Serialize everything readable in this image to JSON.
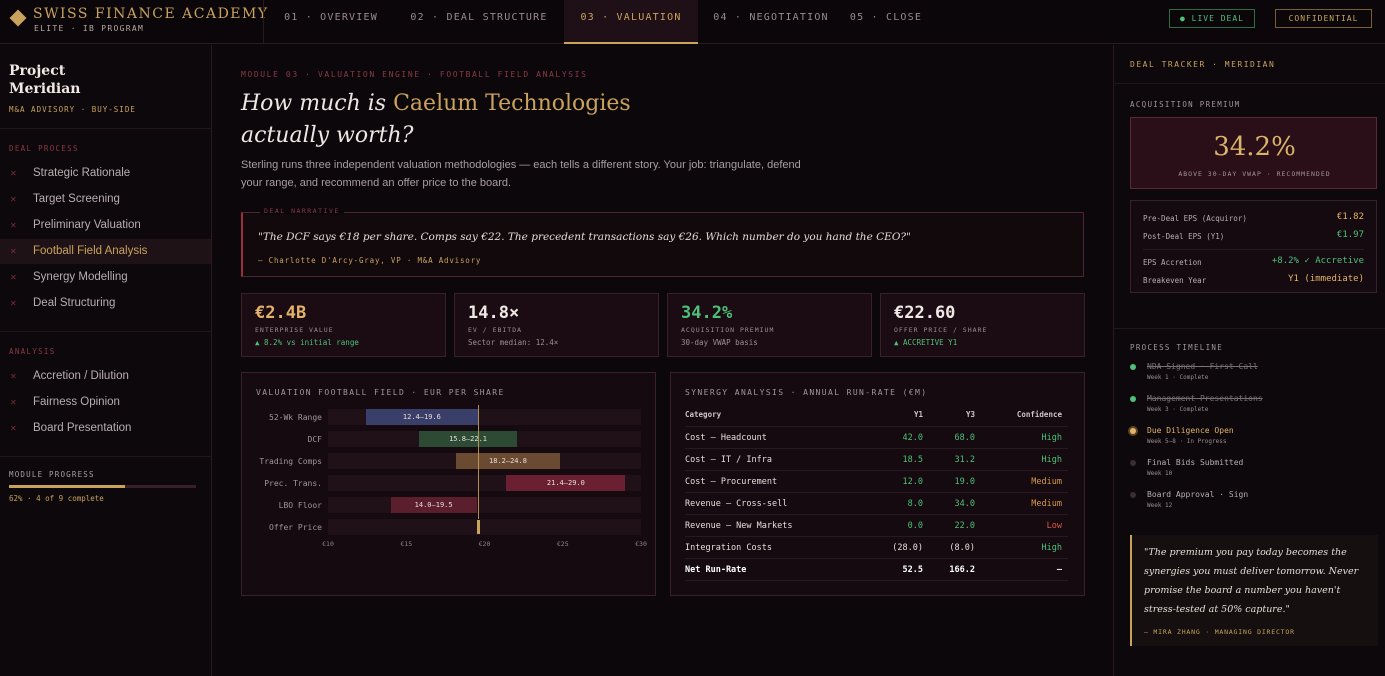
{
  "brand": {
    "title": "SWISS FINANCE ACADEMY",
    "subtitle": "ELITE · IB PROGRAM"
  },
  "tabs": [
    {
      "label": "01 · OVERVIEW",
      "active": false
    },
    {
      "label": "02 · DEAL STRUCTURE",
      "active": false
    },
    {
      "label": "03 · VALUATION",
      "active": true
    },
    {
      "label": "04 · NEGOTIATION",
      "active": false
    },
    {
      "label": "05 · CLOSE",
      "active": false
    }
  ],
  "badges": {
    "live": "● LIVE DEAL",
    "confidential": "CONFIDENTIAL"
  },
  "sidebar": {
    "project_line1": "Project",
    "project_line2": "Meridian",
    "project_sub": "M&A ADVISORY · BUY-SIDE",
    "sections": [
      {
        "heading": "DEAL PROCESS",
        "items": [
          {
            "label": "Strategic Rationale",
            "active": false
          },
          {
            "label": "Target Screening",
            "active": false
          },
          {
            "label": "Preliminary Valuation",
            "active": false
          },
          {
            "label": "Football Field Analysis",
            "active": true
          },
          {
            "label": "Synergy Modelling",
            "active": false
          },
          {
            "label": "Deal Structuring",
            "active": false
          }
        ]
      },
      {
        "heading": "ANALYSIS",
        "items": [
          {
            "label": "Accretion / Dilution",
            "active": false
          },
          {
            "label": "Fairness Opinion",
            "active": false
          },
          {
            "label": "Board Presentation",
            "active": false
          }
        ]
      }
    ],
    "progress_label": "MODULE PROGRESS",
    "progress_fraction": 0.62,
    "progress_text": "62% · 4 of 9 complete"
  },
  "main": {
    "eyebrow": "MODULE 03 · VALUATION ENGINE · FOOTBALL FIELD ANALYSIS",
    "headline_pre": "How much is ",
    "headline_highlight": "Caelum Technologies",
    "headline_post": "actually worth?",
    "intro": "Sterling runs three independent valuation methodologies — each tells a different story. Your job: triangulate, defend your range, and recommend an offer price to the board.",
    "narrative": {
      "label": "DEAL NARRATIVE",
      "quote": "\"The DCF says €18 per share. Comps say €22. The precedent transactions say €26. Which number do you hand the CEO?\"",
      "attribution": "— Charlotte D'Arcy-Gray, VP · M&A Advisory"
    },
    "kpis": [
      {
        "value": "€2.4B",
        "label": "ENTERPRISE VALUE",
        "sub": "▲ 8.2% vs initial range",
        "value_color": "#e3b36a",
        "sub_color": "#4fc07a"
      },
      {
        "value": "14.8×",
        "label": "EV / EBITDA",
        "sub": "Sector median: 12.4×",
        "value_color": "#f0e8e4",
        "sub_color": "#9a8e92"
      },
      {
        "value": "34.2%",
        "label": "ACQUISITION PREMIUM",
        "sub": "30-day VWAP basis",
        "value_color": "#4fc07a",
        "sub_color": "#9a8e92"
      },
      {
        "value": "€22.60",
        "label": "OFFER PRICE / SHARE",
        "sub": "▲ ACCRETIVE Y1",
        "value_color": "#f0e8e4",
        "sub_color": "#4fc07a"
      }
    ]
  },
  "chart_data": {
    "type": "bar",
    "title": "VALUATION FOOTBALL FIELD · EUR PER SHARE",
    "orientation": "horizontal-range",
    "xlim": [
      10,
      30
    ],
    "xticks": [
      "€10",
      "€15",
      "€20",
      "€25",
      "€30"
    ],
    "xtick_values": [
      10,
      15,
      20,
      25,
      30
    ],
    "categories": [
      "52-Wk Range",
      "DCF",
      "Trading Comps",
      "Prec. Trans.",
      "LBO Floor",
      "Offer Price"
    ],
    "ranges": [
      {
        "low": 12.4,
        "high": 19.6,
        "label": "12.4–19.6",
        "color": "#3a3f6a"
      },
      {
        "low": 15.8,
        "high": 22.1,
        "label": "15.8–22.1",
        "color": "#2d4a35"
      },
      {
        "low": 18.2,
        "high": 24.8,
        "label": "18.2–24.8",
        "color": "#6a4a30"
      },
      {
        "low": 21.4,
        "high": 29.0,
        "label": "21.4–29.0",
        "color": "#6a2030"
      },
      {
        "low": 14.0,
        "high": 19.5,
        "label": "14.0–19.5",
        "color": "#5a1e2c"
      }
    ],
    "offer_price": 19.6
  },
  "synergy": {
    "title": "SYNERGY ANALYSIS · ANNUAL RUN-RATE (€M)",
    "headers": [
      "Category",
      "Y1",
      "Y3",
      "Confidence"
    ],
    "rows": [
      {
        "category": "Cost — Headcount",
        "y1": "42.0",
        "y3": "68.0",
        "confidence": "High",
        "conf_color": "#4fc07a",
        "val_color": "#4fc07a"
      },
      {
        "category": "Cost — IT / Infra",
        "y1": "18.5",
        "y3": "31.2",
        "confidence": "High",
        "conf_color": "#4fc07a",
        "val_color": "#4fc07a"
      },
      {
        "category": "Cost — Procurement",
        "y1": "12.0",
        "y3": "19.0",
        "confidence": "Medium",
        "conf_color": "#d89a4a",
        "val_color": "#4fc07a"
      },
      {
        "category": "Revenue — Cross-sell",
        "y1": "8.0",
        "y3": "34.0",
        "confidence": "Medium",
        "conf_color": "#d89a4a",
        "val_color": "#4fc07a"
      },
      {
        "category": "Revenue — New Markets",
        "y1": "0.0",
        "y3": "22.0",
        "confidence": "Low",
        "conf_color": "#e0584a",
        "val_color": "#4fc07a"
      },
      {
        "category": "Integration Costs",
        "y1": "(28.0)",
        "y3": "(8.0)",
        "confidence": "High",
        "conf_color": "#4fc07a",
        "val_color": "#e8dedb"
      },
      {
        "category": "Net Run-Rate",
        "y1": "52.5",
        "y3": "166.2",
        "confidence": "—",
        "conf_color": "#e8dedb",
        "val_color": "#ffffff",
        "bold": true
      }
    ]
  },
  "right": {
    "title": "DEAL TRACKER · MERIDIAN",
    "premium_heading": "ACQUISITION PREMIUM",
    "premium_value": "34.2%",
    "premium_sub": "ABOVE 30-DAY VWAP · RECOMMENDED",
    "eps": [
      {
        "label": "Pre-Deal EPS (Acquiror)",
        "value": "€1.82",
        "color": "#e3b36a"
      },
      {
        "label": "Post-Deal EPS (Y1)",
        "value": "€1.97",
        "color": "#4fc07a"
      },
      {
        "label": "EPS Accretion",
        "value": "+8.2% ✓ Accretive",
        "color": "#4fc07a"
      },
      {
        "label": "Breakeven Year",
        "value": "Y1 (immediate)",
        "color": "#e3b36a"
      }
    ],
    "timeline_heading": "PROCESS TIMELINE",
    "timeline": [
      {
        "title": "NDA Signed · First Call",
        "sub": "Week 1 · Complete",
        "state": "complete"
      },
      {
        "title": "Management Presentations",
        "sub": "Week 3 · Complete",
        "state": "complete"
      },
      {
        "title": "Due Diligence Open",
        "sub": "Week 5–8 · In Progress",
        "state": "active"
      },
      {
        "title": "Final Bids Submitted",
        "sub": "Week 10",
        "state": "pending"
      },
      {
        "title": "Board Approval · Sign",
        "sub": "Week 12",
        "state": "pending"
      }
    ],
    "quote": "\"The premium you pay today becomes the synergies you must deliver tomorrow. Never promise the board a number you haven't stress-tested at 50% capture.\"",
    "quote_attr": "— MIRA ZHANG · MANAGING DIRECTOR"
  }
}
